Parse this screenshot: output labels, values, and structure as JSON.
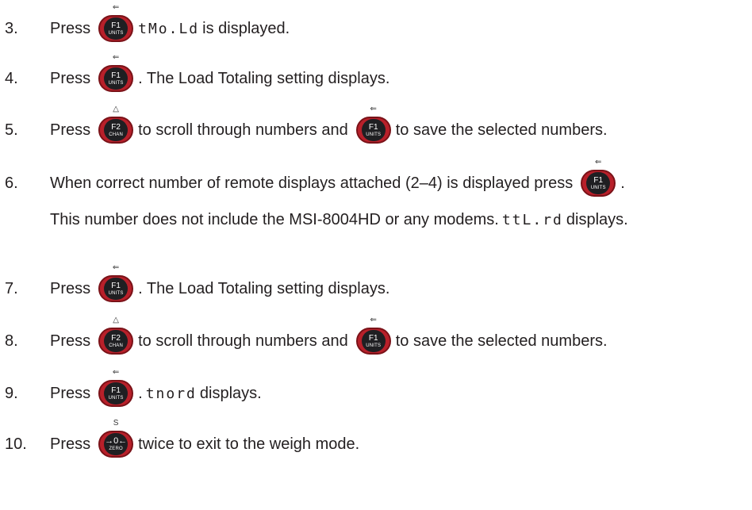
{
  "steps": [
    {
      "num": "3.",
      "parts": [
        {
          "t": "Press"
        },
        {
          "btn": "f1"
        },
        {
          "seg": "tMo.Ld"
        },
        {
          "t": "is displayed."
        }
      ]
    },
    {
      "num": "4.",
      "parts": [
        {
          "t": "Press"
        },
        {
          "btn": "f1"
        },
        {
          "t": ". The Load Totaling setting displays."
        }
      ]
    },
    {
      "num": "5.",
      "parts": [
        {
          "t": "Press"
        },
        {
          "btn": "f2"
        },
        {
          "t": "to scroll through numbers and"
        },
        {
          "btn": "f1"
        },
        {
          "t": "to save the selected numbers."
        }
      ]
    },
    {
      "num": "6.",
      "parts": [
        {
          "t": "When correct number of remote displays attached (2–4) is displayed press"
        },
        {
          "btn": "f1"
        },
        {
          "t": "."
        }
      ],
      "line2": [
        {
          "t": "This number does not include the MSI-8004HD or any modems."
        },
        {
          "seg": "ttL.rd"
        },
        {
          "t": "displays."
        }
      ]
    },
    {
      "num": "7.",
      "parts": [
        {
          "t": "Press"
        },
        {
          "btn": "f1"
        },
        {
          "t": ". The Load Totaling setting displays."
        }
      ]
    },
    {
      "num": "8.",
      "parts": [
        {
          "t": "Press"
        },
        {
          "btn": "f2"
        },
        {
          "t": "to scroll through numbers and"
        },
        {
          "btn": "f1"
        },
        {
          "t": "to save the selected numbers."
        }
      ]
    },
    {
      "num": "9.",
      "parts": [
        {
          "t": "Press"
        },
        {
          "btn": "f1"
        },
        {
          "t": "."
        },
        {
          "seg": "tnord"
        },
        {
          "t": "displays."
        }
      ]
    },
    {
      "num": "10.",
      "parts": [
        {
          "t": "Press"
        },
        {
          "btn": "zero"
        },
        {
          "t": "twice to exit to the weigh mode."
        }
      ]
    }
  ],
  "buttons": {
    "f1": {
      "top": "F1",
      "bottom": "UNITS",
      "arrow": "⇐",
      "icon": "f1-units-key-icon"
    },
    "f2": {
      "top": "F2",
      "bottom": "CHAN",
      "arrow": "△",
      "icon": "f2-chan-key-icon"
    },
    "zero": {
      "top": "→0←",
      "bottom": "ZERO",
      "arrow": "S",
      "icon": "zero-key-icon"
    }
  },
  "colors": {
    "key_red": "#b8202a",
    "key_face": "#1f1f22",
    "text": "#231f20"
  }
}
